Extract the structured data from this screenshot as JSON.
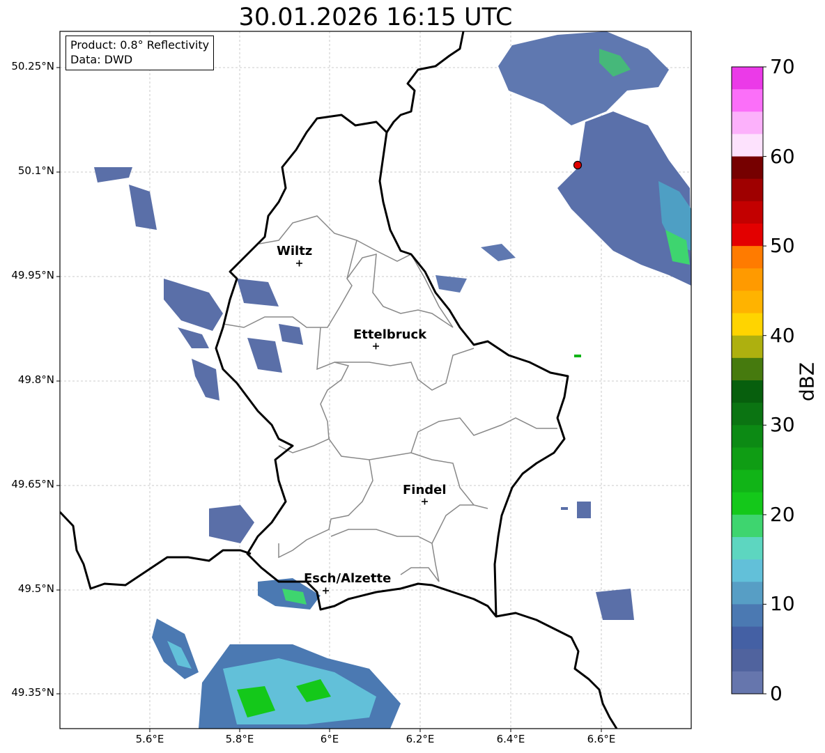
{
  "title": "30.01.2026 16:15 UTC",
  "info_box": {
    "product": "Product: 0.8° Reflectivity",
    "data_source": "Data: DWD"
  },
  "latitude_labels": [
    "50.25°N",
    "50.1°N",
    "49.95°N",
    "49.8°N",
    "49.65°N",
    "49.5°N",
    "49.35°N"
  ],
  "longitude_labels": [
    "5.6°E",
    "5.8°E",
    "6°E",
    "6.2°E",
    "6.4°E",
    "6.6°E"
  ],
  "cities": [
    {
      "name": "Wiltz"
    },
    {
      "name": "Ettelbruck"
    },
    {
      "name": "Findel"
    },
    {
      "name": "Esch/Alzette"
    }
  ],
  "colorbar": {
    "label": "dBZ",
    "ticks": [
      "70",
      "60",
      "50",
      "40",
      "30",
      "20",
      "10",
      "0"
    ],
    "colors": [
      "#eb3ae8",
      "#fb6ff9",
      "#fcb1fb",
      "#fde2fd",
      "#760000",
      "#9f0000",
      "#c30000",
      "#e30000",
      "#ff7b00",
      "#ff9a00",
      "#ffb300",
      "#ffd400",
      "#aeb00f",
      "#467a0e",
      "#075f0d",
      "#0b7412",
      "#0c8a14",
      "#0f9d14",
      "#11b417",
      "#14c81a",
      "#3ed56f",
      "#5dd6c0",
      "#62c0d9",
      "#579ec5",
      "#4b79b2",
      "#4460a4",
      "#50639e",
      "#6676ad"
    ]
  },
  "radar_site_color": "#e00000"
}
